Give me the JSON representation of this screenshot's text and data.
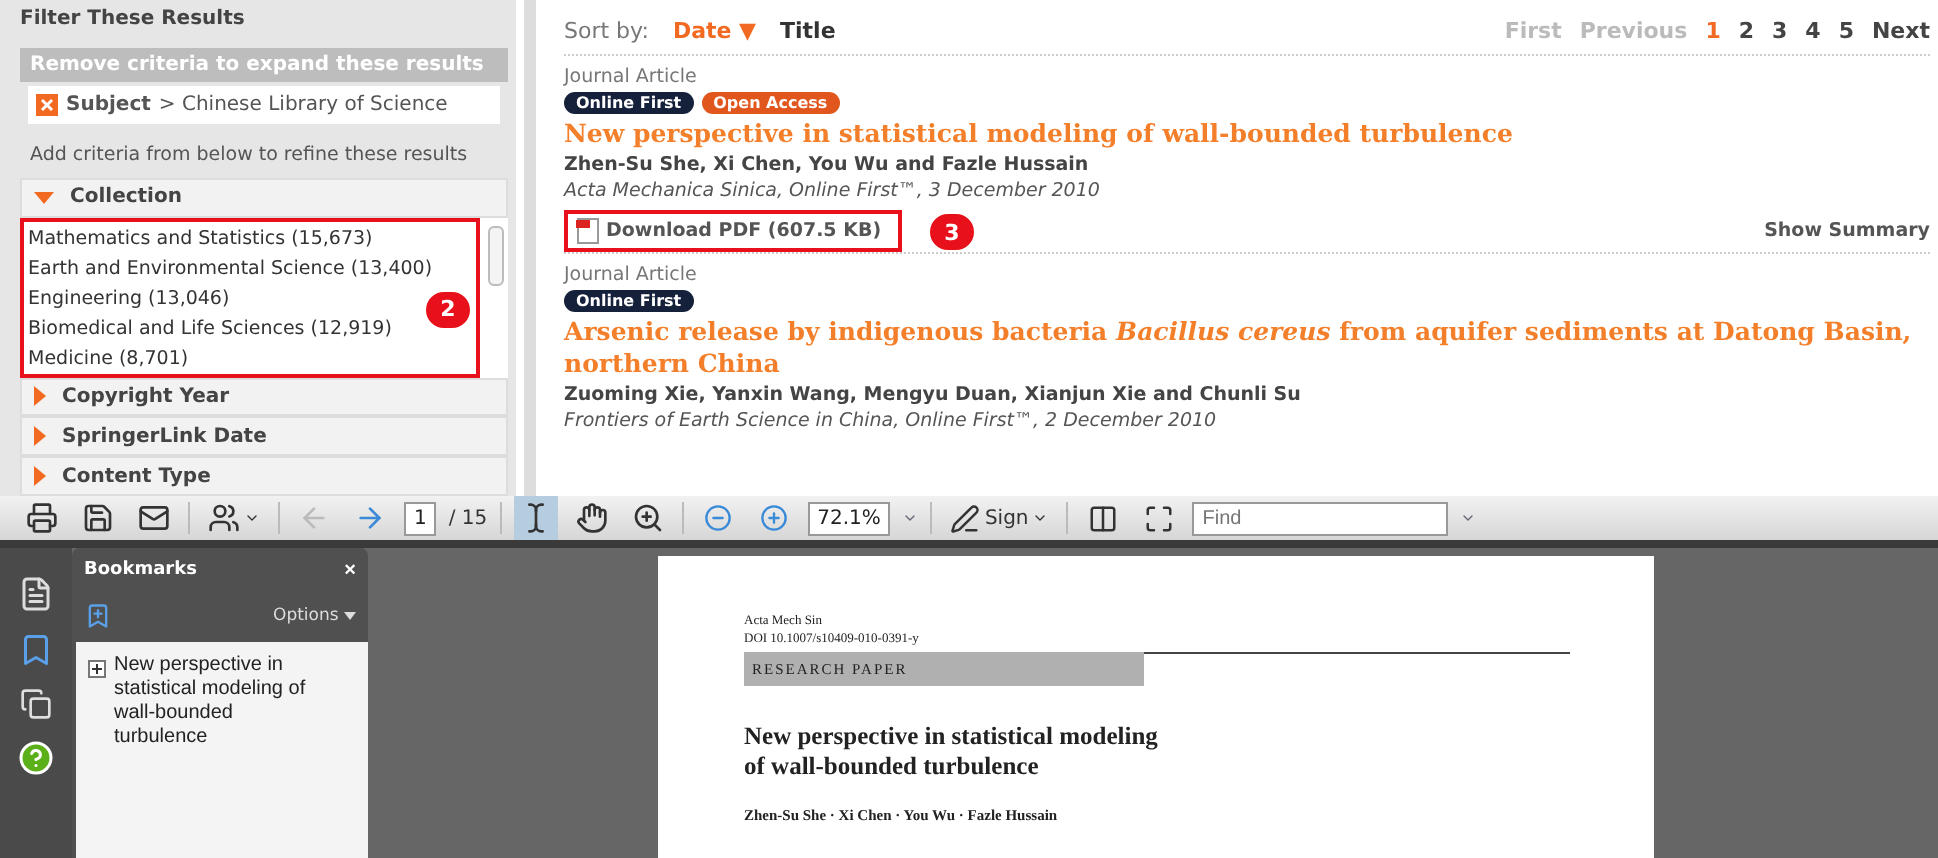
{
  "filter_panel": {
    "title": "Filter These Results",
    "remove_header": "Remove criteria to expand these results",
    "criterion": {
      "field": "Subject",
      "value": "> Chinese Library of Science"
    },
    "add_hint": "Add criteria from below to refine these results",
    "sections": [
      {
        "label": "Collection",
        "expanded": true,
        "items": [
          "Mathematics and Statistics (15,673)",
          "Earth and Environmental Science (13,400)",
          "Engineering (13,046)",
          "Biomedical and Life Sciences (12,919)",
          "Medicine (8,701)"
        ]
      },
      {
        "label": "Copyright Year",
        "expanded": false
      },
      {
        "label": "SpringerLink Date",
        "expanded": false
      },
      {
        "label": "Content Type",
        "expanded": false
      }
    ],
    "callout": "2"
  },
  "results": {
    "sort_label": "Sort by:",
    "sort_options": [
      {
        "label": "Date ▼",
        "selected": true
      },
      {
        "label": "Title",
        "selected": false
      }
    ],
    "pagination": [
      {
        "label": "First",
        "selected": false,
        "disabled": true
      },
      {
        "label": "Previous",
        "selected": false,
        "disabled": true
      },
      {
        "label": "1",
        "selected": true,
        "disabled": false
      },
      {
        "label": "2",
        "selected": false,
        "disabled": false
      },
      {
        "label": "3",
        "selected": false,
        "disabled": false
      },
      {
        "label": "4",
        "selected": false,
        "disabled": false
      },
      {
        "label": "5",
        "selected": false,
        "disabled": false
      },
      {
        "label": "Next",
        "selected": false,
        "disabled": false
      }
    ],
    "articles": [
      {
        "type": "Journal Article",
        "badges": [
          {
            "label": "Online First",
            "kind": "online"
          },
          {
            "label": "Open Access",
            "kind": "open"
          }
        ],
        "title": "New perspective in statistical modeling of wall-bounded turbulence",
        "authors": "Zhen-Su She, Xi Chen, You Wu and Fazle Hussain",
        "source": "Acta Mechanica Sinica, Online First™, 3 December 2010",
        "download": "Download PDF (607.5 KB)",
        "callout": "3",
        "summary": "Show Summary"
      },
      {
        "type": "Journal Article",
        "badges": [
          {
            "label": "Online First",
            "kind": "online"
          }
        ],
        "title": "Arsenic release by indigenous bacteria *Bacillus cereus* from aquifer sediments at Datong Basin, northern China",
        "authors": "Zuoming Xie, Yanxin Wang, Mengyu Duan, Xianjun Xie and Chunli Su",
        "source": "Frontiers of Earth Science in China, Online First™, 2 December 2010"
      }
    ]
  },
  "pdf_toolbar": {
    "page": "1",
    "page_total": "/ 15",
    "zoom": "72.1%",
    "sign": "Sign",
    "find_placeholder": "Find",
    "select_tool_selected": true
  },
  "bookmarks": {
    "title": "Bookmarks",
    "close": "×",
    "options": "Options",
    "items": [
      {
        "label": "New perspective in statistical modeling of wall-bounded turbulence",
        "expanded": false
      }
    ]
  },
  "document": {
    "journal": "Acta Mech Sin",
    "doi": "DOI 10.1007/s10409-010-0391-y",
    "section": "RESEARCH PAPER",
    "title_lines": [
      "New perspective in statistical modeling",
      "of wall-bounded turbulence"
    ],
    "authors": "Zhen-Su She · Xi Chen · You Wu · Fazle Hussain"
  }
}
